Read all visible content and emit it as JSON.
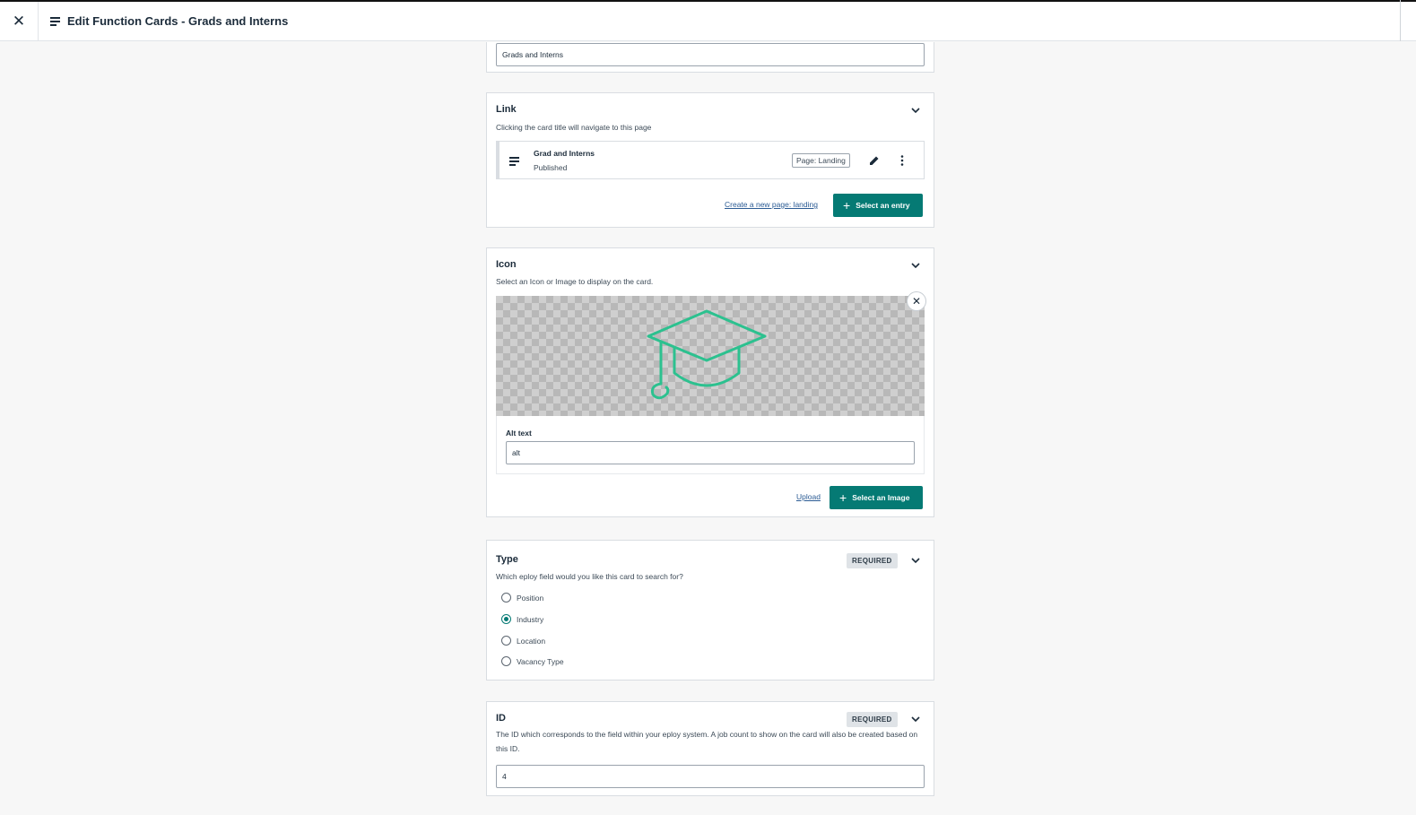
{
  "header": {
    "close_glyph": "✕",
    "title": "Edit Function Cards - Grads and Interns"
  },
  "title_field": {
    "value": "Grads and Interns"
  },
  "link": {
    "title": "Link",
    "help": "Clicking the card title will navigate to this page",
    "entry": {
      "name": "Grad and Interns",
      "status": "Published",
      "content_type": "Page: Landing"
    },
    "create_link": "Create a new page: landing",
    "select_button": "Select an entry"
  },
  "icon": {
    "title": "Icon",
    "help": "Select an Icon or Image to display on the card.",
    "preview_icon": "graduation-cap-icon",
    "accent_color": "#2cc18f",
    "alt_label": "Alt text",
    "alt_value": "alt",
    "upload_link": "Upload",
    "select_button": "Select an Image"
  },
  "type": {
    "title": "Type",
    "required": "REQUIRED",
    "help": "Which eploy field would you like this card to search for?",
    "options": [
      {
        "label": "Position",
        "selected": false
      },
      {
        "label": "Industry",
        "selected": true
      },
      {
        "label": "Location",
        "selected": false
      },
      {
        "label": "Vacancy Type",
        "selected": false
      }
    ]
  },
  "id": {
    "title": "ID",
    "required": "REQUIRED",
    "help": "The ID which corresponds to the field within your eploy system. A job count to show on the card will also be created based on this ID.",
    "value": "4"
  },
  "colors": {
    "primary": "#057a74",
    "accent": "#2cc18f",
    "link": "#2b5b94"
  }
}
